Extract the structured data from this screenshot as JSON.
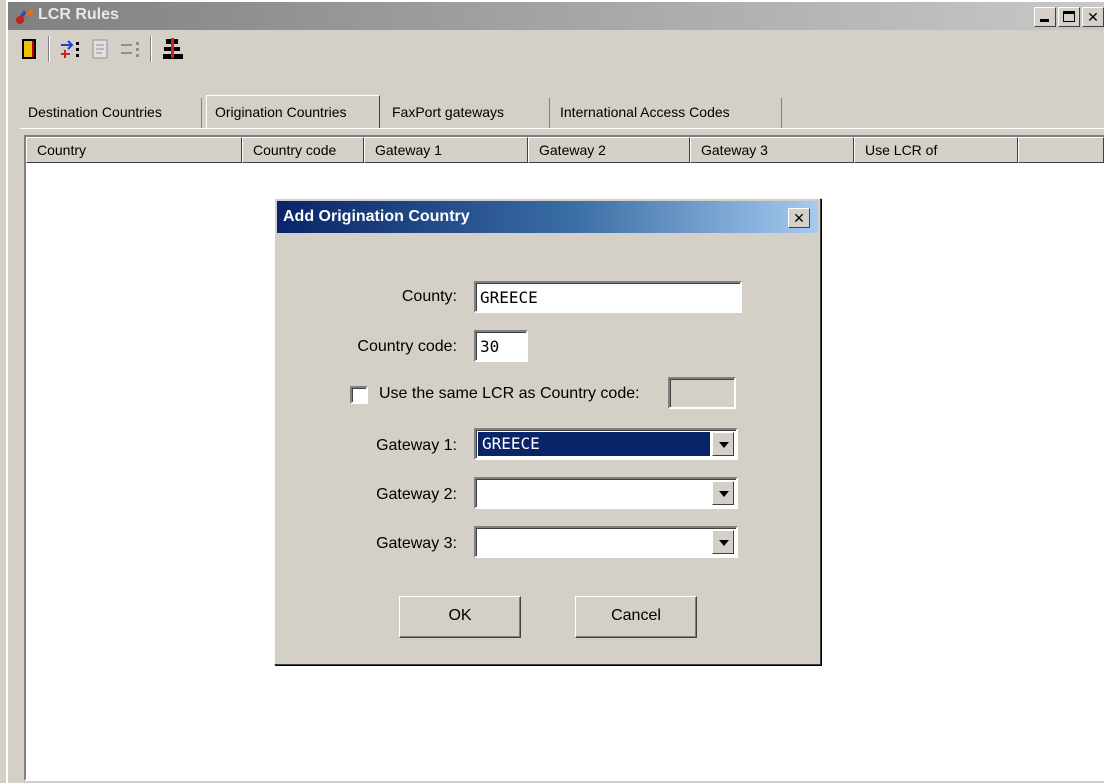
{
  "window": {
    "title": "LCR Rules"
  },
  "toolbar": {
    "buttons": [
      {
        "name": "exit-icon"
      },
      {
        "name": "add-rule-icon"
      },
      {
        "name": "edit-rule-icon"
      },
      {
        "name": "delete-rule-icon"
      },
      {
        "name": "lcr-tree-icon"
      }
    ]
  },
  "tabs": [
    {
      "label": "Destination Countries"
    },
    {
      "label": "Origination Countries"
    },
    {
      "label": "FaxPort  gateways"
    },
    {
      "label": "International Access Codes"
    }
  ],
  "active_tab": "Origination Countries",
  "table": {
    "columns": [
      "Country",
      "Country code",
      "Gateway 1",
      "Gateway 2",
      "Gateway 3",
      "Use LCR of"
    ]
  },
  "dialog": {
    "title": "Add Origination Country",
    "country_label": "County:",
    "country_value": "GREECE",
    "country_code_label": "Country code:",
    "country_code_value": "30",
    "same_lcr_label": "Use the same LCR as Country code:",
    "same_lcr_checked": false,
    "same_lcr_value": "",
    "gateway1_label": "Gateway 1:",
    "gateway1_value": "GREECE",
    "gateway2_label": "Gateway 2:",
    "gateway2_value": "",
    "gateway3_label": "Gateway 3:",
    "gateway3_value": "",
    "ok_label": "OK",
    "cancel_label": "Cancel"
  },
  "colors": {
    "face": "#d4d0c8",
    "active_title": "#0a246a",
    "inactive_title": "#808080",
    "selection": "#0a246a"
  }
}
